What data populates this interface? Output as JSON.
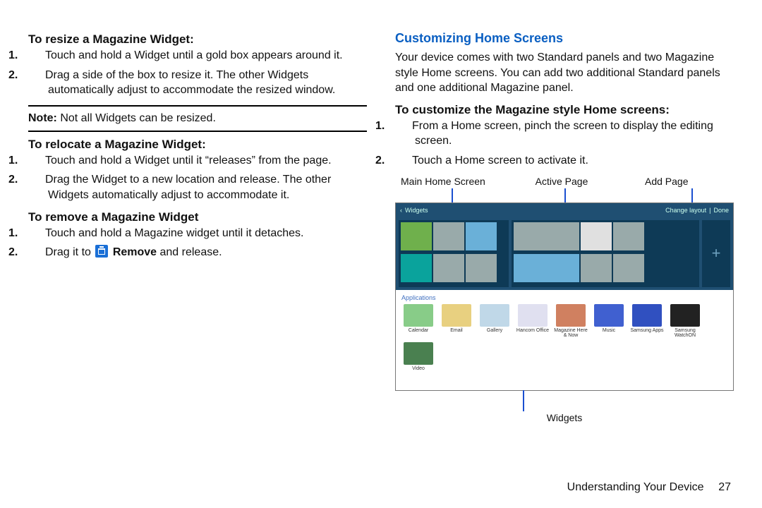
{
  "left": {
    "resize": {
      "heading": "To resize a Magazine Widget:",
      "items": [
        "Touch and hold a Widget until a gold box appears around it.",
        "Drag a side of the box to resize it. The other Widgets automatically adjust to accommodate the resized window."
      ]
    },
    "note": {
      "label": "Note:",
      "text": " Not all Widgets can be resized."
    },
    "relocate": {
      "heading": "To relocate a Magazine Widget:",
      "items": [
        "Touch and hold a Widget until it “releases” from the page.",
        "Drag the Widget to a new location and release. The other Widgets automatically adjust to accommodate it."
      ]
    },
    "remove": {
      "heading": "To remove a Magazine Widget",
      "item1": "Touch and hold a Magazine widget until it detaches.",
      "item2_pre": "Drag it to ",
      "item2_post": " and release.",
      "remove_word": "Remove"
    }
  },
  "right": {
    "heading": "Customizing Home Screens",
    "intro": "Your device comes with two Standard panels and two Magazine style Home screens. You can add two additional Standard panels and one additional Magazine panel.",
    "customize": {
      "heading": "To customize the Magazine style Home screens:",
      "items": [
        "From a Home screen, pinch the screen to display the editing screen.",
        "Touch a Home screen to activate it."
      ]
    },
    "labels": {
      "main": "Main Home Screen",
      "active": "Active Page",
      "add": "Add Page",
      "widgets": "Widgets"
    },
    "device": {
      "back": "‹",
      "title": "Widgets",
      "change": "Change layout",
      "done": "Done",
      "apps_title": "Applications",
      "apps": [
        {
          "name": "Calendar"
        },
        {
          "name": "Email"
        },
        {
          "name": "Gallery"
        },
        {
          "name": "Hancom Office"
        },
        {
          "name": "Magazine Here & Now"
        },
        {
          "name": "Music"
        },
        {
          "name": "Samsung Apps"
        },
        {
          "name": "Samsung WatchON"
        },
        {
          "name": "Video"
        }
      ]
    }
  },
  "footer": {
    "section": "Understanding Your Device",
    "page": "27"
  }
}
